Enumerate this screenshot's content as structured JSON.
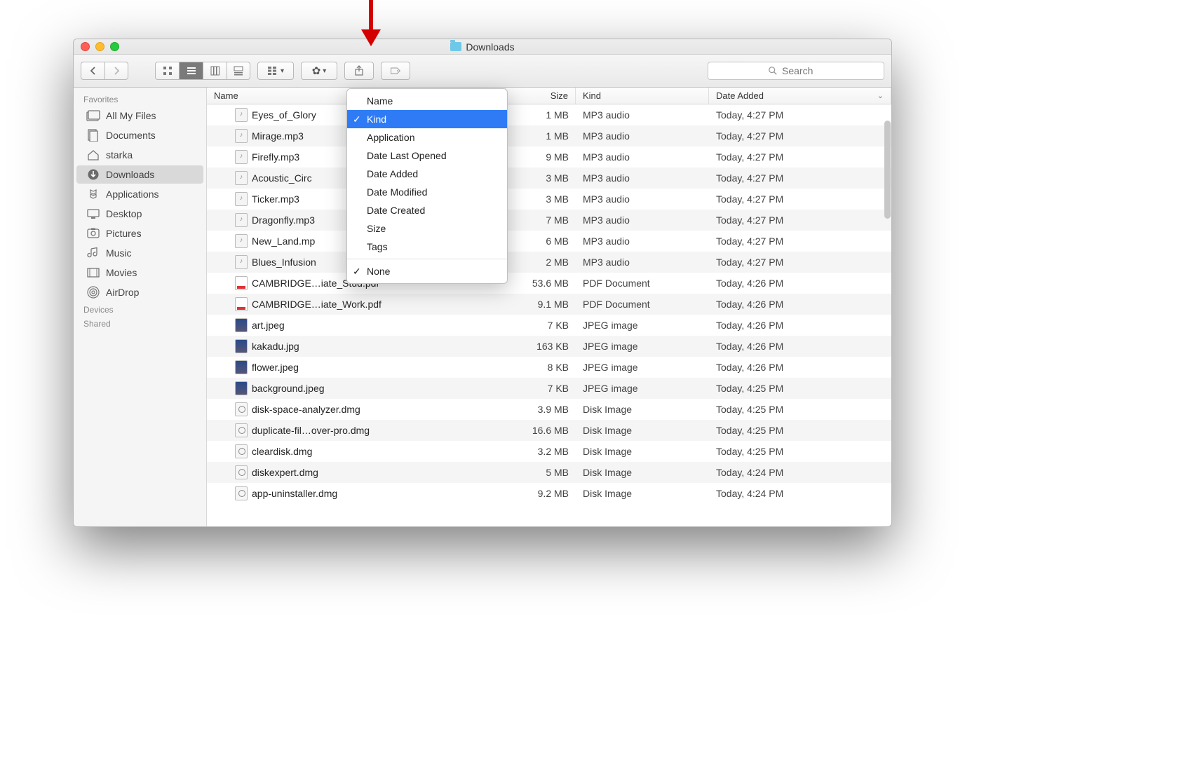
{
  "window": {
    "title": "Downloads"
  },
  "toolbar": {
    "search_placeholder": "Search"
  },
  "sidebar": {
    "sections": [
      {
        "header": "Favorites",
        "items": [
          {
            "label": "All My Files",
            "icon": "allfiles",
            "active": false
          },
          {
            "label": "Documents",
            "icon": "documents",
            "active": false
          },
          {
            "label": "starka",
            "icon": "home",
            "active": false
          },
          {
            "label": "Downloads",
            "icon": "downloads",
            "active": true
          },
          {
            "label": "Applications",
            "icon": "applications",
            "active": false
          },
          {
            "label": "Desktop",
            "icon": "desktop",
            "active": false
          },
          {
            "label": "Pictures",
            "icon": "pictures",
            "active": false
          },
          {
            "label": "Music",
            "icon": "music",
            "active": false
          },
          {
            "label": "Movies",
            "icon": "movies",
            "active": false
          },
          {
            "label": "AirDrop",
            "icon": "airdrop",
            "active": false
          }
        ]
      },
      {
        "header": "Devices",
        "items": []
      },
      {
        "header": "Shared",
        "items": []
      }
    ]
  },
  "columns": {
    "name": "Name",
    "size": "Size",
    "kind": "Kind",
    "date": "Date Added"
  },
  "dropdown": {
    "items": [
      "Name",
      "Kind",
      "Application",
      "Date Last Opened",
      "Date Added",
      "Date Modified",
      "Date Created",
      "Size",
      "Tags"
    ],
    "selected": "Kind",
    "none": "None",
    "noneChecked": true
  },
  "files": [
    {
      "name": "Eyes_of_Glory",
      "size": "1 MB",
      "kind": "MP3 audio",
      "date": "Today, 4:27 PM",
      "type": "audio"
    },
    {
      "name": "Mirage.mp3",
      "size": "1 MB",
      "kind": "MP3 audio",
      "date": "Today, 4:27 PM",
      "type": "audio"
    },
    {
      "name": "Firefly.mp3",
      "size": "9 MB",
      "kind": "MP3 audio",
      "date": "Today, 4:27 PM",
      "type": "audio"
    },
    {
      "name": "Acoustic_Circ",
      "size": "3 MB",
      "kind": "MP3 audio",
      "date": "Today, 4:27 PM",
      "type": "audio"
    },
    {
      "name": "Ticker.mp3",
      "size": "3 MB",
      "kind": "MP3 audio",
      "date": "Today, 4:27 PM",
      "type": "audio"
    },
    {
      "name": "Dragonfly.mp3",
      "size": "7 MB",
      "kind": "MP3 audio",
      "date": "Today, 4:27 PM",
      "type": "audio"
    },
    {
      "name": "New_Land.mp",
      "size": "6 MB",
      "kind": "MP3 audio",
      "date": "Today, 4:27 PM",
      "type": "audio"
    },
    {
      "name": "Blues_Infusion",
      "size": "2 MB",
      "kind": "MP3 audio",
      "date": "Today, 4:27 PM",
      "type": "audio"
    },
    {
      "name": "CAMBRIDGE…iate_Stud.pdf",
      "size": "53.6 MB",
      "kind": "PDF Document",
      "date": "Today, 4:26 PM",
      "type": "pdf"
    },
    {
      "name": "CAMBRIDGE…iate_Work.pdf",
      "size": "9.1 MB",
      "kind": "PDF Document",
      "date": "Today, 4:26 PM",
      "type": "pdf"
    },
    {
      "name": "art.jpeg",
      "size": "7 KB",
      "kind": "JPEG image",
      "date": "Today, 4:26 PM",
      "type": "img"
    },
    {
      "name": "kakadu.jpg",
      "size": "163 KB",
      "kind": "JPEG image",
      "date": "Today, 4:26 PM",
      "type": "img"
    },
    {
      "name": "flower.jpeg",
      "size": "8 KB",
      "kind": "JPEG image",
      "date": "Today, 4:26 PM",
      "type": "img"
    },
    {
      "name": "background.jpeg",
      "size": "7 KB",
      "kind": "JPEG image",
      "date": "Today, 4:25 PM",
      "type": "img"
    },
    {
      "name": "disk-space-analyzer.dmg",
      "size": "3.9 MB",
      "kind": "Disk Image",
      "date": "Today, 4:25 PM",
      "type": "dmg"
    },
    {
      "name": "duplicate-fil…over-pro.dmg",
      "size": "16.6 MB",
      "kind": "Disk Image",
      "date": "Today, 4:25 PM",
      "type": "dmg"
    },
    {
      "name": "cleardisk.dmg",
      "size": "3.2 MB",
      "kind": "Disk Image",
      "date": "Today, 4:25 PM",
      "type": "dmg"
    },
    {
      "name": "diskexpert.dmg",
      "size": "5 MB",
      "kind": "Disk Image",
      "date": "Today, 4:24 PM",
      "type": "dmg"
    },
    {
      "name": "app-uninstaller.dmg",
      "size": "9.2 MB",
      "kind": "Disk Image",
      "date": "Today, 4:24 PM",
      "type": "dmg"
    }
  ]
}
